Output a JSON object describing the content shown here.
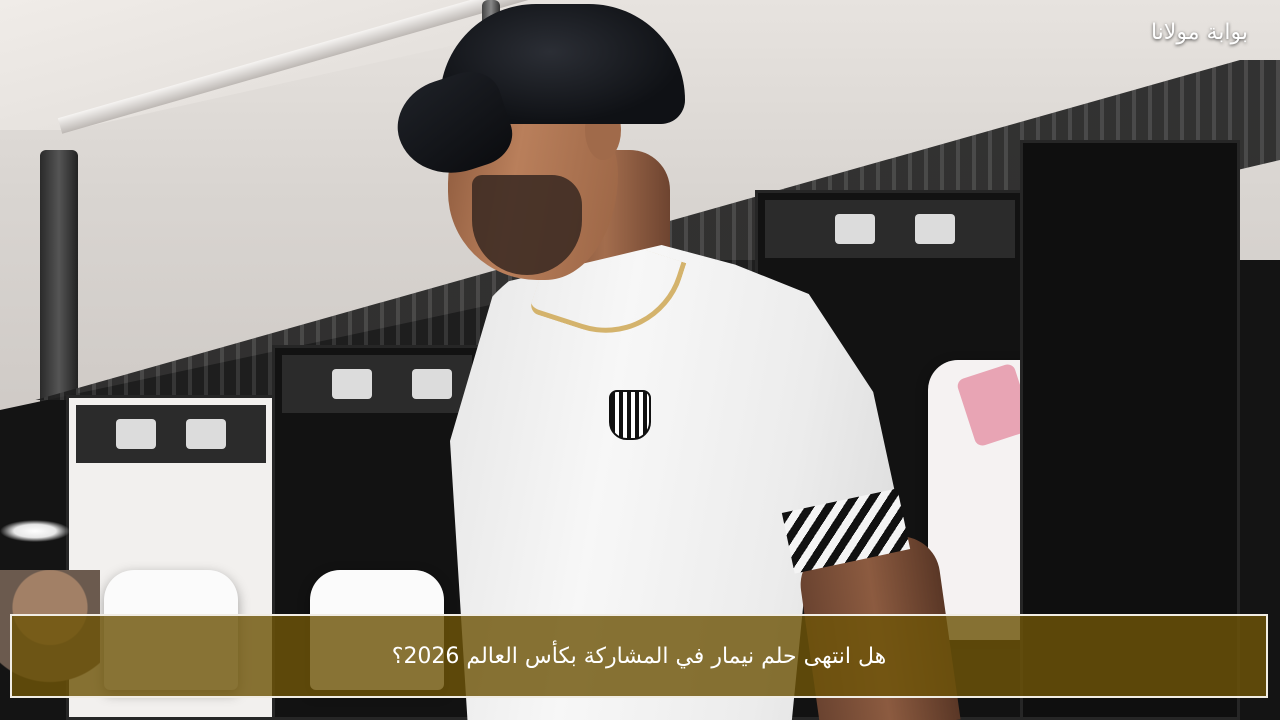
{
  "brand": {
    "name": "بوابة مولانا"
  },
  "headline": {
    "text": "هل انتهى حلم نيمار في المشاركة بكأس العالم 2026؟"
  },
  "style": {
    "caption_bg": "#6e5408",
    "caption_border": "#f1ede4",
    "text_color": "#ffffff"
  }
}
